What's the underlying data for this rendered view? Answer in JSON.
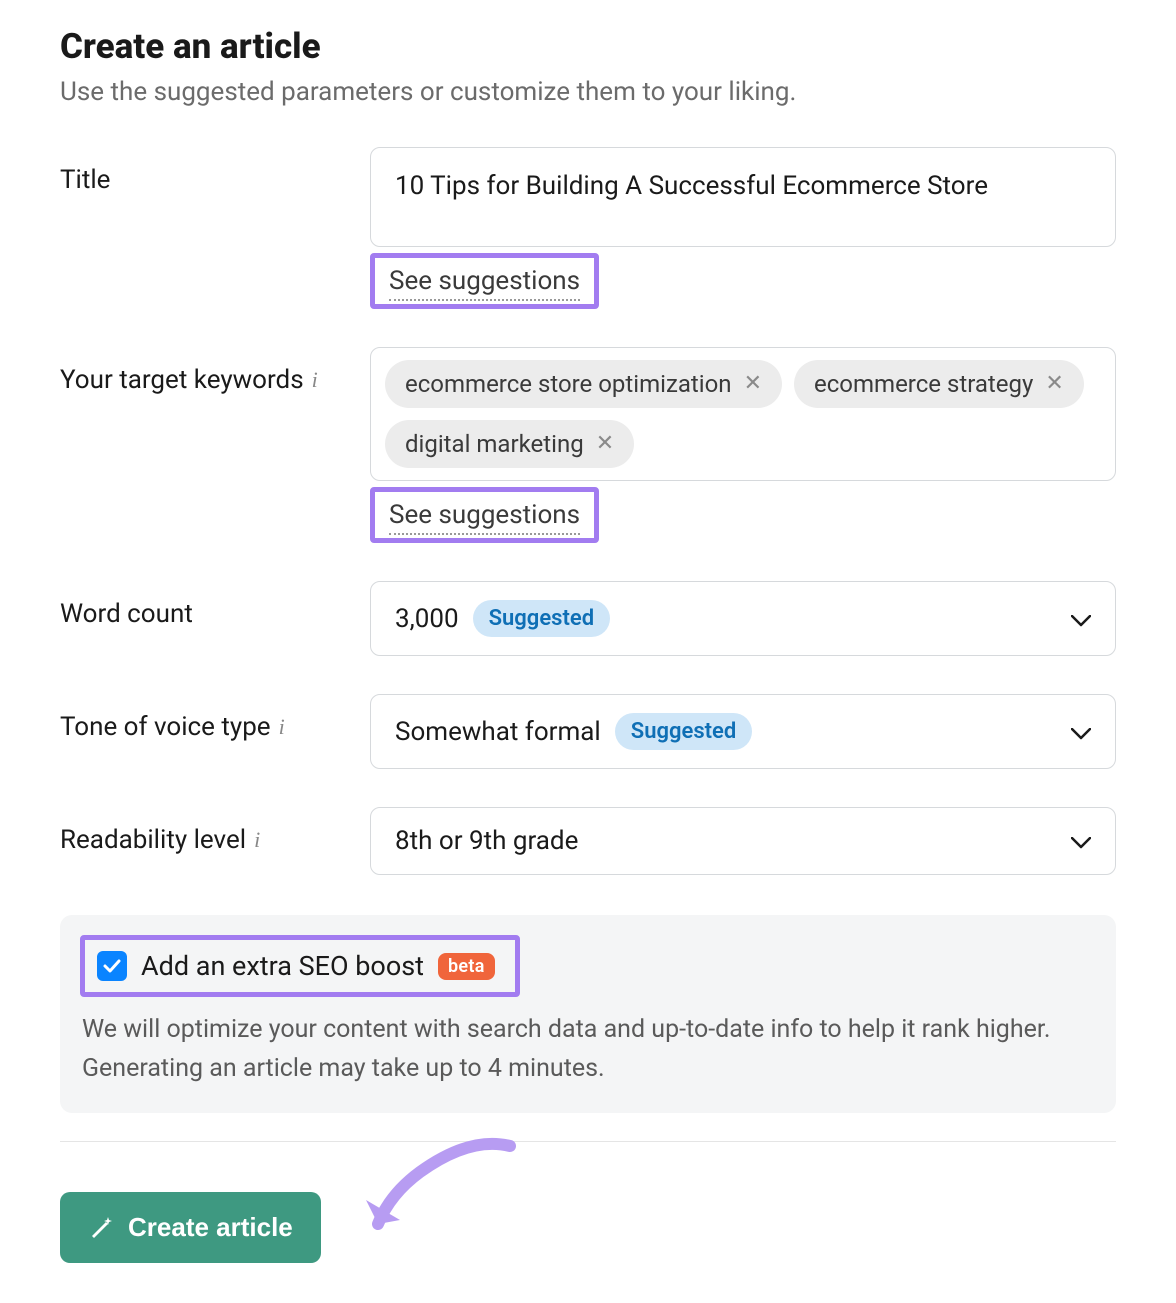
{
  "header": {
    "title": "Create an article",
    "subtitle": "Use the suggested parameters or customize them to your liking."
  },
  "labels": {
    "title": "Title",
    "keywords": "Your target keywords",
    "word_count": "Word count",
    "tone": "Tone of voice type",
    "readability": "Readability level",
    "see_suggestions": "See suggestions",
    "suggested_badge": "Suggested"
  },
  "fields": {
    "title_value": "10 Tips for Building A Successful Ecommerce Store",
    "keywords": [
      "ecommerce store optimization",
      "ecommerce strategy",
      "digital marketing"
    ],
    "word_count_value": "3,000",
    "tone_value": "Somewhat formal",
    "readability_value": "8th or 9th grade"
  },
  "seo": {
    "checked": true,
    "title": "Add an extra SEO boost",
    "badge": "beta",
    "description": "We will optimize your content with search data and up-to-date info to help it rank higher. Generating an article may take up to 4 minutes."
  },
  "footer": {
    "create_button": "Create article"
  }
}
